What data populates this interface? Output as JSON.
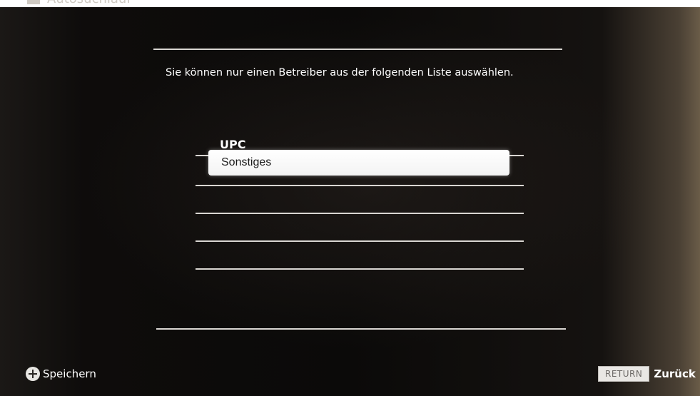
{
  "header": {
    "title": "Autosuchlauf"
  },
  "instruction": "Sie können nur einen Betreiber aus der folgenden Liste auswählen.",
  "operator_list": {
    "items": [
      {
        "label": "UPC",
        "selected": false
      },
      {
        "label": "Sonstiges",
        "selected": true
      }
    ]
  },
  "footer": {
    "save_label": "Speichern",
    "return_key": "RETURN",
    "back_label": "Zurück"
  },
  "colors": {
    "background": "#0b0a09",
    "text": "#ffffff",
    "highlight": "#ffffff"
  }
}
